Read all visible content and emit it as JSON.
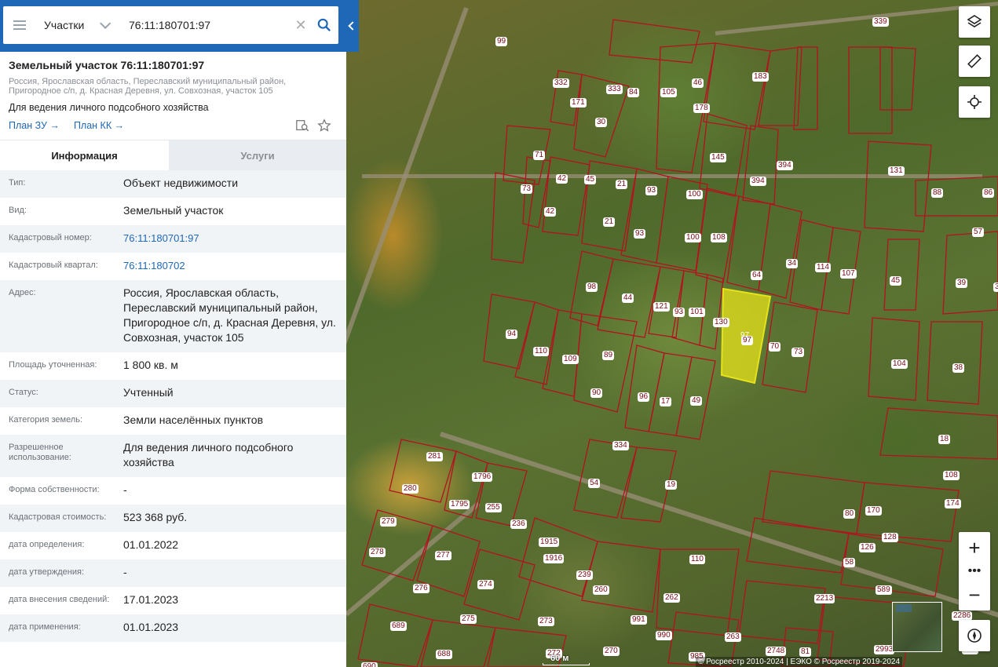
{
  "search": {
    "category": "Участки",
    "query": "76:11:180701:97"
  },
  "object": {
    "title": "Земельный участок 76:11:180701:97",
    "address_line": "Россия, Ярославская область, Переславский муниципальный район, Пригородное с/п, д. Красная Деревня, ул. Совхозная, участок 105",
    "purpose": "Для ведения личного подсобного хозяйства",
    "link_plan_zu": "План ЗУ →",
    "link_plan_kk": "План КК →"
  },
  "tabs": {
    "info": "Информация",
    "services": "Услуги"
  },
  "rows": [
    {
      "label": "Тип:",
      "value": "Объект недвижимости"
    },
    {
      "label": "Вид:",
      "value": "Земельный участок"
    },
    {
      "label": "Кадастровый номер:",
      "value": "76:11:180701:97"
    },
    {
      "label": "Кадастровый квартал:",
      "value": "76:11:180702"
    },
    {
      "label": "Адрес:",
      "value": "Россия, Ярославская область, Переславский муниципальный район, Пригородное с/п, д. Красная Деревня, ул. Совхозная, участок 105"
    },
    {
      "label": "Площадь уточненная:",
      "value": "1 800 кв. м"
    },
    {
      "label": "Статус:",
      "value": "Учтенный"
    },
    {
      "label": "Категория земель:",
      "value": "Земли населённых пунктов"
    },
    {
      "label": "Разрешенное использование:",
      "value": "Для ведения личного подсобного хозяйства"
    },
    {
      "label": "Форма собственности:",
      "value": "-"
    },
    {
      "label": "Кадастровая стоимость:",
      "value": "523 368 руб."
    },
    {
      "label": "дата определения:",
      "value": "01.01.2022"
    },
    {
      "label": "дата утверждения:",
      "value": "-"
    },
    {
      "label": "дата внесения сведений:",
      "value": "17.01.2023"
    },
    {
      "label": "дата применения:",
      "value": "01.01.2023"
    }
  ],
  "map": {
    "scale_label": "60 м",
    "copyright": "© Росреестр 2010-2024 | ЕЭКО © Росреестр 2019-2024",
    "parcel_labels": [
      "99",
      "332",
      "333",
      "84",
      "105",
      "46",
      "183",
      "339",
      "171",
      "30",
      "178",
      "131",
      "88",
      "86",
      "71",
      "145",
      "394",
      "394",
      "42",
      "45",
      "21",
      "93",
      "100",
      "57",
      "73",
      "42",
      "21",
      "93",
      "100",
      "108",
      "64",
      "34",
      "114",
      "107",
      "73",
      "45",
      "39",
      "31",
      "98",
      "44",
      "121",
      "93",
      "101",
      "130",
      "97",
      "70",
      "73",
      "94",
      "110",
      "109",
      "89",
      "104",
      "38",
      "90",
      "96",
      "17",
      "49",
      "18",
      "281",
      "1796",
      "334",
      "54",
      "19",
      "108",
      "280",
      "1795",
      "255",
      "236",
      "170",
      "174",
      "80",
      "279",
      "1915",
      "128",
      "126",
      "278",
      "277",
      "1916",
      "239",
      "110",
      "58",
      "276",
      "274",
      "589",
      "260",
      "2213",
      "275",
      "262",
      "2286",
      "689",
      "273",
      "991",
      "990",
      "263",
      "2993",
      "591",
      "688",
      "272",
      "270",
      "985",
      "2748",
      "81",
      "690"
    ],
    "highlight_label": "97",
    "colors": {
      "parcel_line": "#b3121f",
      "highlight_fill": "#e6e21a",
      "brand": "#1f67b7"
    }
  }
}
